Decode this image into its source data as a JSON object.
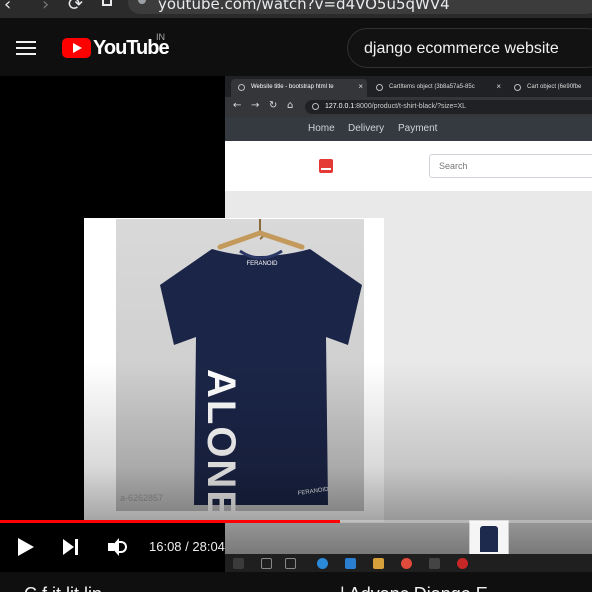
{
  "browser": {
    "back_glyph": "‹",
    "forward_glyph": "›",
    "reload_glyph": "⟳",
    "url": "youtube.com/watch?v=d4VO5u5qWV4"
  },
  "youtube": {
    "logo_text": "YouTube",
    "country_code": "IN",
    "search_query": "django ecommerce website"
  },
  "recording": {
    "tabs": [
      {
        "label": "Website title - bootstrap html te",
        "active": true
      },
      {
        "label": "CartItems object (3b8a57a5-85c",
        "active": false
      },
      {
        "label": "Cart object (6e90fbe",
        "active": false
      }
    ],
    "url_host": "127.0.0.1",
    "url_rest": ":8000/product/t-shirt-black/?size=XL",
    "site_nav": [
      "Home",
      "Delivery",
      "Payment"
    ],
    "search_placeholder": "Search",
    "product": {
      "brand": "FERANOID",
      "print_text": "ALONE",
      "code": "a-6262857",
      "shirt_color": "#1b2547"
    }
  },
  "player": {
    "current_time": "16:08",
    "total_time": "28:04",
    "time_display": "16:08 / 28:04",
    "progress_fraction": 0.575,
    "accent": "#ff0000"
  },
  "below": {
    "title_part_1": "C       f         it       lit      lin",
    "title_part_2": "| Advanc    Django E"
  },
  "colors": {
    "page_bg": "#0f0f0f",
    "yt_red": "#ff0000",
    "site_nav_bg": "#343a40"
  }
}
